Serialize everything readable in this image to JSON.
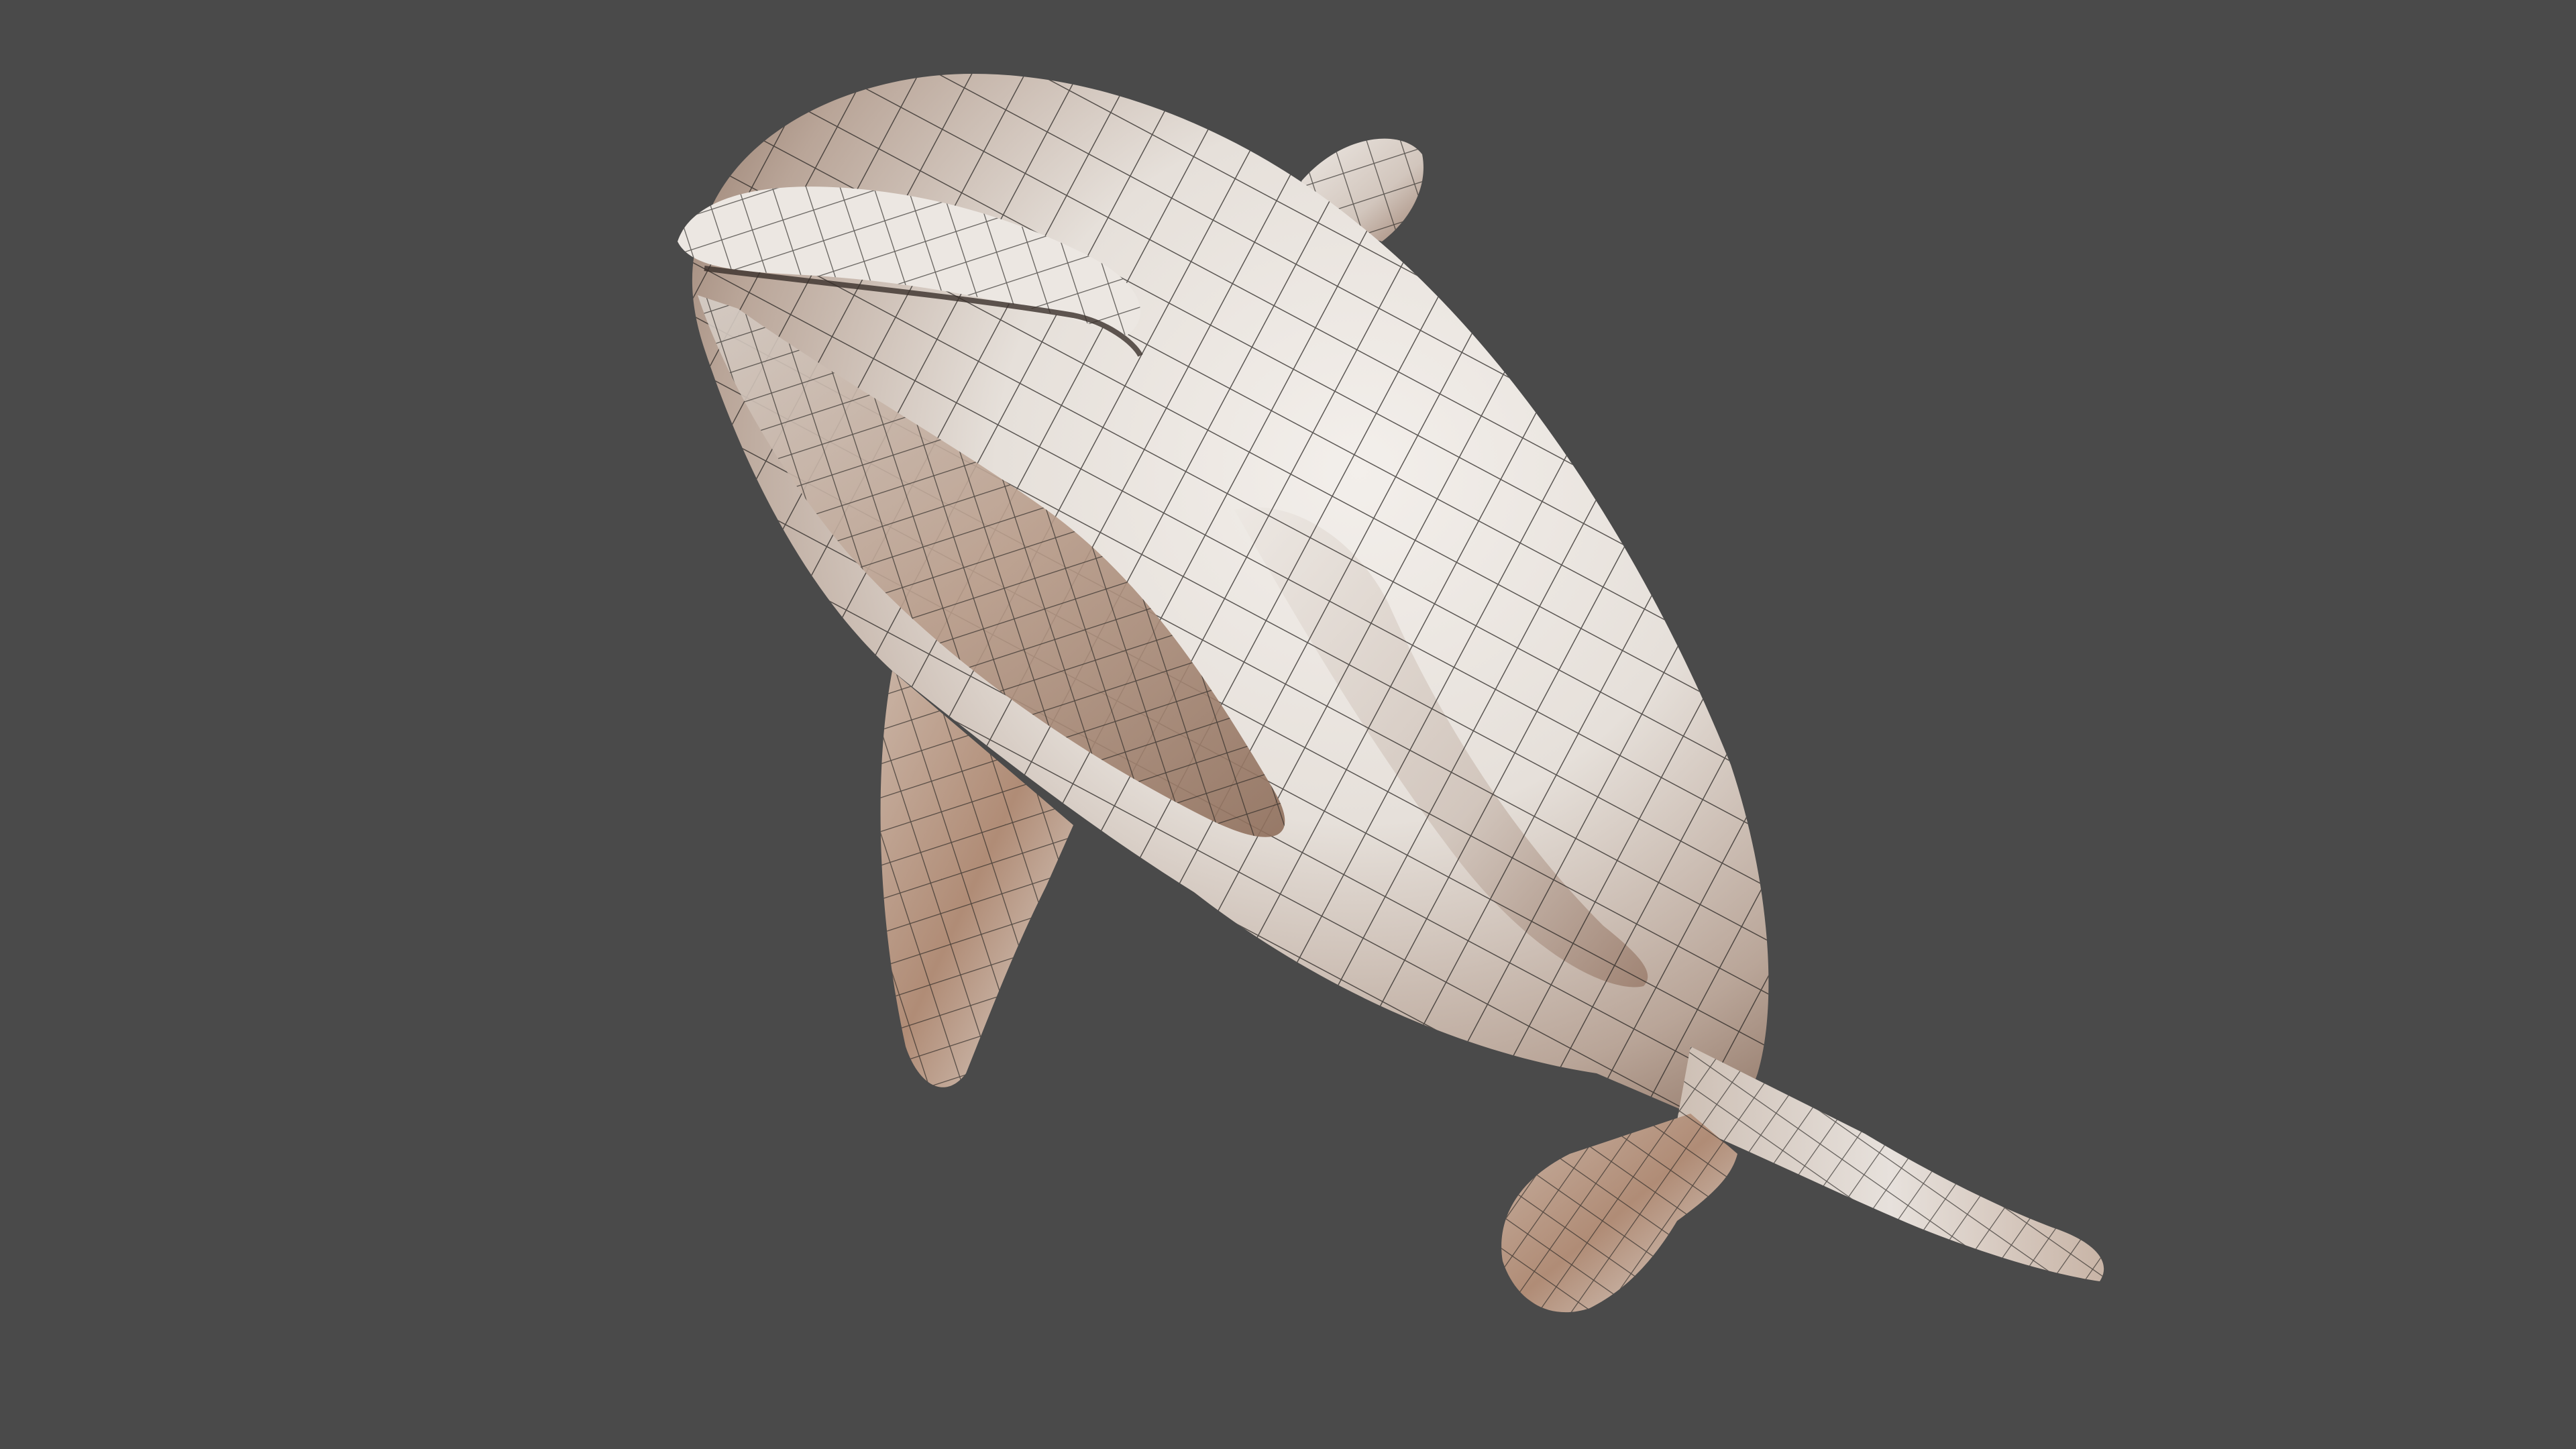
{
  "scene": {
    "background_color": "#4a4a4a",
    "subject": "dolphin-wireframe-model",
    "mesh_color": "#f0ece8",
    "wire_color": "#2a2624",
    "shadow_tint": "#b88d74"
  }
}
